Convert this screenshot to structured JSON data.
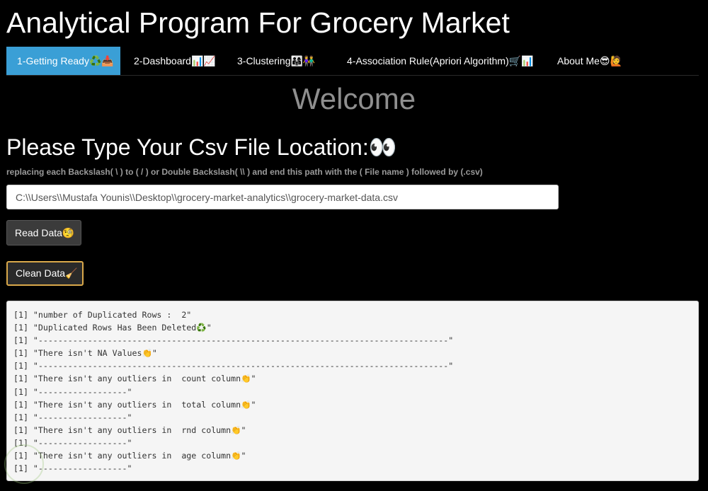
{
  "app": {
    "title": "Analytical Program For Grocery Market"
  },
  "tabs": [
    {
      "label": "1-Getting Ready♻️📥",
      "active": true
    },
    {
      "label": "2-Dashboard📊📈",
      "active": false
    },
    {
      "label": "3-Clustering👨‍👩‍👧👫",
      "active": false
    },
    {
      "label": "4-Association Rule(Apriori Algorithm)🛒📊",
      "active": false
    },
    {
      "label": "About Me😎🙋",
      "active": false
    }
  ],
  "main": {
    "welcome": "Welcome",
    "heading": "Please Type Your Csv File Location:👀",
    "hint": "replacing each Backslash( \\ ) to ( / ) or Double Backslash( \\\\ ) and end this path with the ( File name ) followed by (.csv)",
    "path_value": "C:\\\\Users\\\\Mustafa Younis\\\\Desktop\\\\grocery-market-analytics\\\\grocery-market-data.csv",
    "read_button": "Read Data🧐",
    "clean_button": "Clean Data🧹"
  },
  "console": {
    "lines": [
      "[1] \"number of Duplicated Rows :  2\"",
      "[1] \"Duplicated Rows Has Been Deleted♻️\"",
      "[1] \"-----------------------------------------------------------------------------------\"",
      "[1] \"There isn't NA Values👏\"",
      "[1] \"-----------------------------------------------------------------------------------\"",
      "[1] \"There isn't any outliers in  count column👏\"",
      "[1] \"------------------\"",
      "[1] \"There isn't any outliers in  total column👏\"",
      "[1] \"------------------\"",
      "[1] \"There isn't any outliers in  rnd column👏\"",
      "[1] \"------------------\"",
      "[1] \"There isn't any outliers in  age column👏\"",
      "[1] \"------------------\""
    ]
  },
  "colors": {
    "background": "#000000",
    "active_tab": "#3a9fd6",
    "welcome_text": "#8f8f8f",
    "clean_button_border": "#d9a84a",
    "console_bg": "#f5f5f5"
  }
}
